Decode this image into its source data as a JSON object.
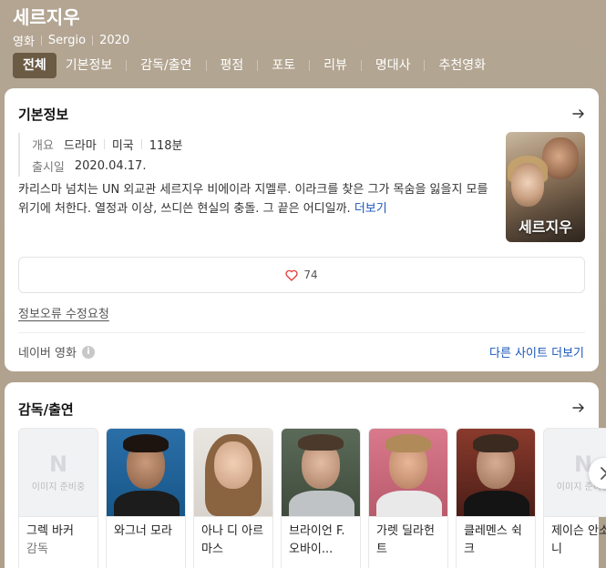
{
  "header": {
    "title": "세르지우",
    "meta": [
      "영화",
      "Sergio",
      "2020"
    ],
    "tabs": [
      "전체",
      "기본정보",
      "감독/출연",
      "평점",
      "포토",
      "리뷰",
      "명대사",
      "추천영화"
    ],
    "active_tab": "전체"
  },
  "basic_info": {
    "section_title": "기본정보",
    "overview_label": "개요",
    "genre": "드라마",
    "country": "미국",
    "runtime": "118분",
    "release_label": "출시일",
    "release_date": "2020.04.17.",
    "description": "카리스마 넘치는 UN 외교관 세르지우 비에이라 지멜루. 이라크를 찾은 그가 목숨을 잃을지 모를 위기에 처한다. 열정과 이상, 쓰디쓴 현실의 충돌. 그 끝은 어디일까.",
    "more_label": "더보기",
    "poster_title": "세르지우",
    "like_count": "74",
    "report_label": "정보오류 수정요청",
    "source_label": "네이버 영화",
    "more_sites_label": "다른 사이트 더보기"
  },
  "cast": {
    "section_title": "감독/출연",
    "no_image_text": "이미지 준비중",
    "people": [
      {
        "name": "그렉 바커",
        "role": "감독",
        "has_image": false
      },
      {
        "name": "와그너 모라",
        "role": "",
        "has_image": true
      },
      {
        "name": "아나 디 아르마스",
        "role": "",
        "has_image": true
      },
      {
        "name": "브라이언 F. 오바이...",
        "role": "",
        "has_image": true
      },
      {
        "name": "가렛 딜라헌트",
        "role": "",
        "has_image": true
      },
      {
        "name": "클레멘스 쉭크",
        "role": "",
        "has_image": true
      },
      {
        "name": "제이슨 안소니",
        "role": "",
        "has_image": false
      }
    ]
  },
  "colors": {
    "background": "#b1a48f",
    "active_tab": "#6b5a44",
    "link": "#1a56b8",
    "heart": "#e53935"
  }
}
